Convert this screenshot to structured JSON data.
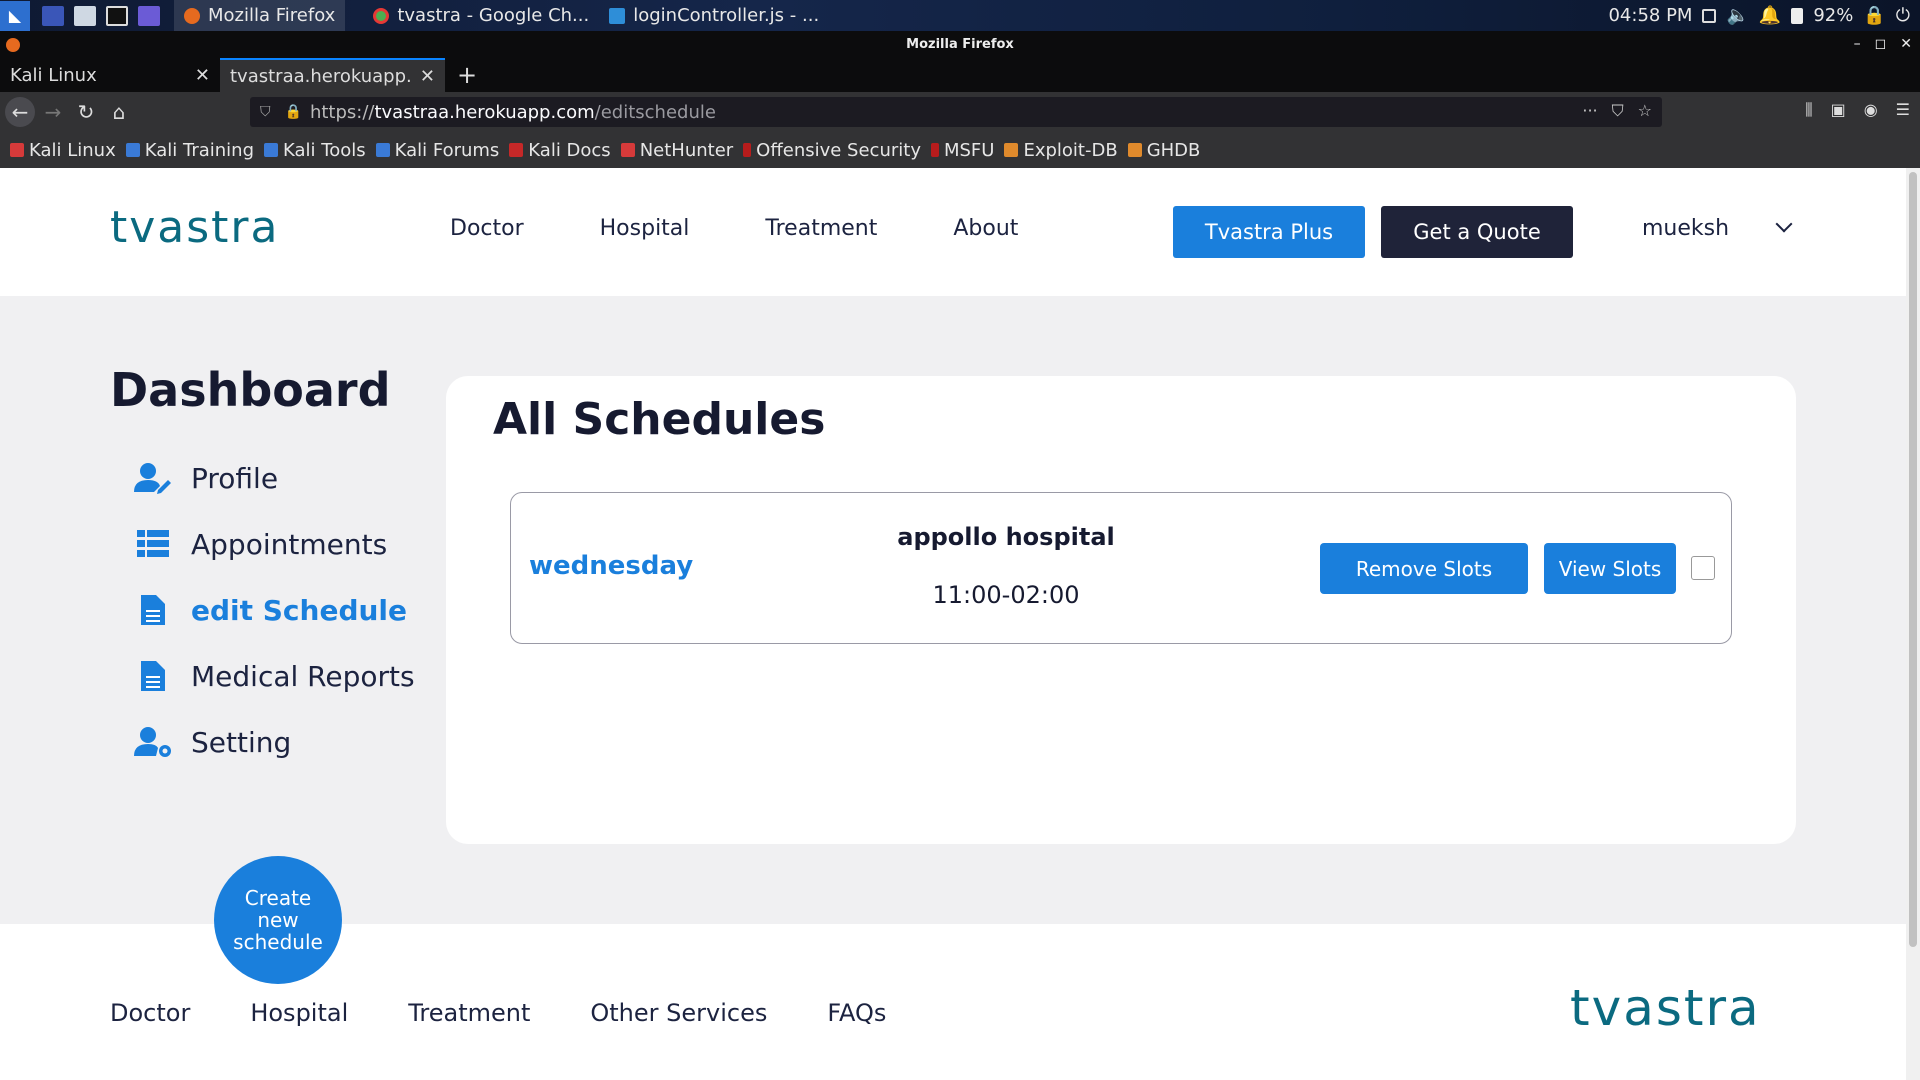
{
  "os_panel": {
    "tasks": [
      {
        "label": "Mozilla Firefox",
        "icon": "firefox-icon",
        "active": true
      },
      {
        "label": "tvastra - Google Ch...",
        "icon": "chrome-icon",
        "active": false
      },
      {
        "label": "loginController.js - ...",
        "icon": "vscode-icon",
        "active": false
      }
    ],
    "time": "04:58 PM",
    "battery": "92%"
  },
  "browser": {
    "window_title": "Mozilla Firefox",
    "tabs": [
      {
        "label": "Kali Linux",
        "active": false
      },
      {
        "label": "tvastraa.herokuapp.com/editschedule",
        "active": true
      }
    ],
    "url_scheme": "https://",
    "url_host": "tvastraa.herokuapp.com",
    "url_path": "/editschedule",
    "bookmarks": [
      "Kali Linux",
      "Kali Training",
      "Kali Tools",
      "Kali Forums",
      "Kali Docs",
      "NetHunter",
      "Offensive Security",
      "MSFU",
      "Exploit-DB",
      "GHDB"
    ]
  },
  "site": {
    "logo_text": "tvastra",
    "nav": [
      "Doctor",
      "Hospital",
      "Treatment",
      "About"
    ],
    "plus_button": "Tvastra Plus",
    "quote_button": "Get a Quote",
    "username": "mueksh",
    "brand_color": "#1a7fdc",
    "dark_color": "#1f2339"
  },
  "dashboard": {
    "title": "Dashboard",
    "sidebar": [
      {
        "label": "Profile",
        "icon": "user-edit-icon"
      },
      {
        "label": "Appointments",
        "icon": "list-icon"
      },
      {
        "label": "edit Schedule",
        "icon": "file-icon",
        "active": true
      },
      {
        "label": "Medical Reports",
        "icon": "file-icon"
      },
      {
        "label": "Setting",
        "icon": "user-gear-icon"
      }
    ],
    "create_button": "Create new schedule"
  },
  "schedules": {
    "title": "All Schedules",
    "items": [
      {
        "day": "wednesday",
        "hospital": "appollo hospital",
        "time": "11:00-02:00",
        "remove_label": "Remove Slots",
        "view_label": "View Slots"
      }
    ]
  },
  "footer": {
    "nav": [
      "Doctor",
      "Hospital",
      "Treatment",
      "Other Services",
      "FAQs"
    ],
    "logo_text": "tvastra"
  }
}
